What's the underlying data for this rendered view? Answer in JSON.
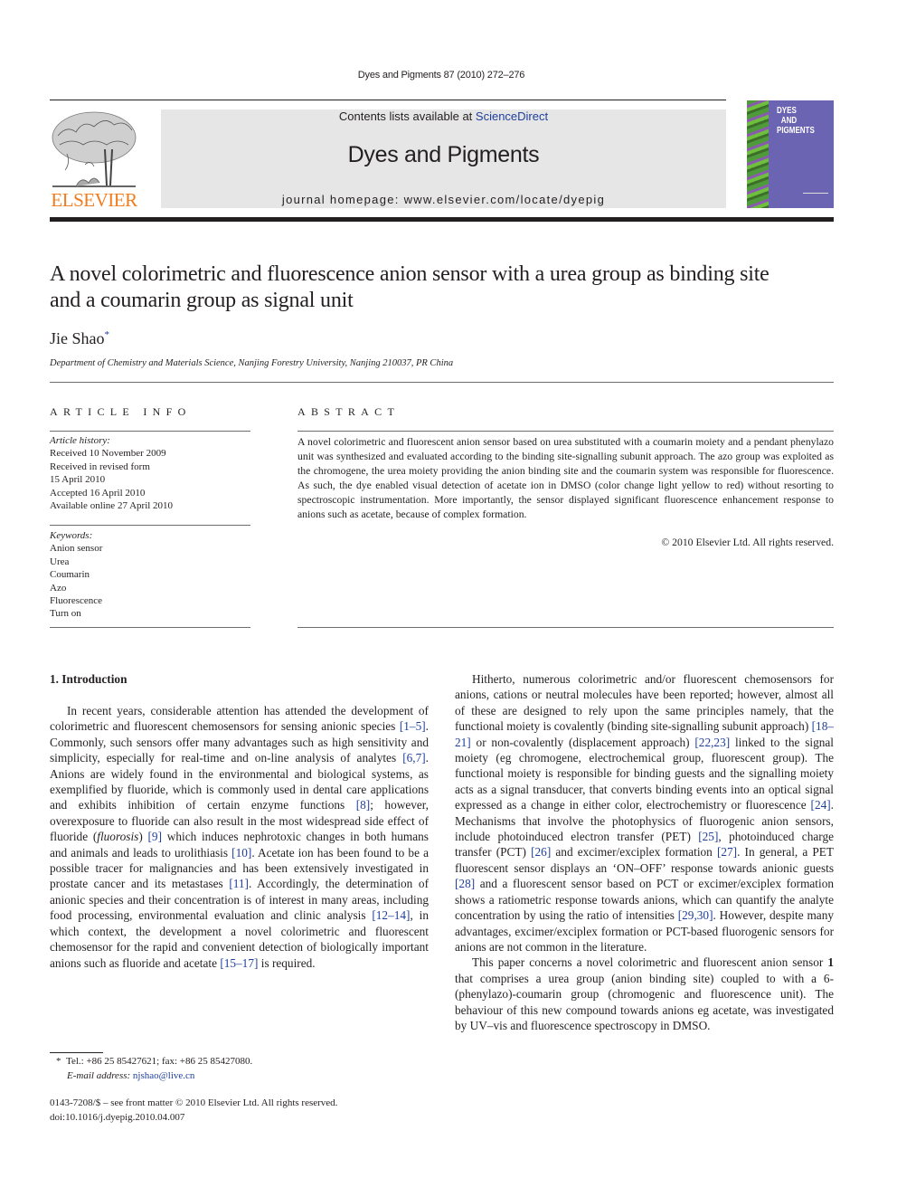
{
  "running_head": "Dyes and Pigments 87 (2010) 272–276",
  "banner": {
    "contents_prefix": "Contents lists available at ",
    "contents_link": "ScienceDirect",
    "journal_title": "Dyes and Pigments",
    "homepage": "journal homepage: www.elsevier.com/locate/dyepig"
  },
  "publisher_logo": {
    "wordmark": "ELSEVIER",
    "color": "#f07c1d"
  },
  "cover": {
    "title_lines": [
      "Dyes",
      "and",
      "Pigments"
    ],
    "color": "#6b64b2"
  },
  "article": {
    "title": "A novel colorimetric and fluorescence anion sensor with a urea group as binding site and a coumarin group as signal unit",
    "author": "Jie Shao",
    "author_mark": "*",
    "affiliation": "Department of Chemistry and Materials Science, Nanjing Forestry University, Nanjing 210037, PR China"
  },
  "article_info": {
    "heading": "ARTICLE INFO",
    "history_label": "Article history:",
    "history": [
      "Received 10 November 2009",
      "Received in revised form",
      "15 April 2010",
      "Accepted 16 April 2010",
      "Available online 27 April 2010"
    ],
    "keywords_label": "Keywords:",
    "keywords": [
      "Anion sensor",
      "Urea",
      "Coumarin",
      "Azo",
      "Fluorescence",
      "Turn on"
    ]
  },
  "abstract": {
    "heading": "ABSTRACT",
    "text": "A novel colorimetric and fluorescent anion sensor based on urea substituted with a coumarin moiety and a pendant phenylazo unit was synthesized and evaluated according to the binding site-signalling subunit approach. The azo group was exploited as the chromogene, the urea moiety providing the anion binding site and the coumarin system was responsible for fluorescence. As such, the dye enabled visual detection of acetate ion in DMSO (color change light yellow to red) without resorting to spectroscopic instrumentation. More importantly, the sensor displayed significant fluorescence enhancement response to anions such as acetate, because of complex formation.",
    "copyright": "© 2010 Elsevier Ltd. All rights reserved."
  },
  "introduction": {
    "heading": "1.  Introduction",
    "left_paragraph": [
      {
        "t": "In recent years, considerable attention has attended the development of colorimetric and fluorescent chemosensors for sensing anionic species "
      },
      {
        "ref": "[1–5]"
      },
      {
        "t": ". Commonly, such sensors offer many advantages such as high sensitivity and simplicity, especially for real-time and on-line analysis of analytes "
      },
      {
        "ref": "[6,7]"
      },
      {
        "t": ". Anions are widely found in the environmental and biological systems, as exemplified by fluoride, which is commonly used in dental care applications and exhibits inhibition of certain enzyme functions "
      },
      {
        "ref": "[8]"
      },
      {
        "t": "; however, overexposure to fluoride can also result in the most widespread side effect of fluoride ("
      },
      {
        "i": "fluorosis"
      },
      {
        "t": ") "
      },
      {
        "ref": "[9]"
      },
      {
        "t": " which induces nephrotoxic changes in both humans and animals and leads to urolithiasis "
      },
      {
        "ref": "[10]"
      },
      {
        "t": ". Acetate ion has been found to be a possible tracer for malignancies and has been extensively investigated in prostate cancer and its metastases "
      },
      {
        "ref": "[11]"
      },
      {
        "t": ". Accordingly, the determination of anionic species and their concentration is of interest in many areas, including food processing, environmental evaluation and clinic analysis "
      },
      {
        "ref": "[12–14]"
      },
      {
        "t": ", in which context, the development a novel colorimetric and fluorescent chemosensor for the rapid and convenient detection of biologically important anions such as fluoride and acetate "
      },
      {
        "ref": "[15–17]"
      },
      {
        "t": " is required."
      }
    ],
    "right_paragraph_1": [
      {
        "t": "Hitherto, numerous colorimetric and/or fluorescent chemosensors for anions, cations or neutral molecules have been reported; however, almost all of these are designed to rely upon the same principles namely, that the functional moiety is covalently (binding site-signalling subunit approach) "
      },
      {
        "ref": "[18–21]"
      },
      {
        "t": " or non-covalently (displacement approach) "
      },
      {
        "ref": "[22,23]"
      },
      {
        "t": " linked to the signal moiety (eg chromogene, electrochemical group, fluorescent group). The functional moiety is responsible for binding guests and the signalling moiety acts as a signal transducer, that converts binding events into an optical signal expressed as a change in either color, electrochemistry or fluorescence "
      },
      {
        "ref": "[24]"
      },
      {
        "t": ". Mechanisms that involve the photophysics of fluorogenic anion sensors, include photoinduced electron transfer (PET) "
      },
      {
        "ref": "[25]"
      },
      {
        "t": ", photoinduced charge transfer (PCT) "
      },
      {
        "ref": "[26]"
      },
      {
        "t": " and excimer/exciplex formation "
      },
      {
        "ref": "[27]"
      },
      {
        "t": ". In general, a PET fluorescent sensor displays an ‘ON–OFF’ response towards anionic guests "
      },
      {
        "ref": "[28]"
      },
      {
        "t": " and a fluorescent sensor based on PCT or excimer/exciplex formation shows a ratiometric response towards anions, which can quantify the analyte concentration by using the ratio of intensities "
      },
      {
        "ref": "[29,30]"
      },
      {
        "t": ". However, despite many advantages, excimer/exciplex formation or PCT-based fluorogenic sensors for anions are not common in the literature."
      }
    ],
    "right_paragraph_2": [
      {
        "t": "This paper concerns a novel colorimetric and fluorescent anion sensor "
      },
      {
        "b": "1"
      },
      {
        "t": " that comprises a urea group (anion binding site) coupled to with a 6-(phenylazo)-coumarin group (chromogenic and fluorescence unit). The behaviour of this new compound towards anions eg acetate, was investigated by UV–vis and fluorescence spectroscopy in DMSO."
      }
    ]
  },
  "footnote": {
    "mark": "*",
    "contact": "Tel.: +86 25 85427621; fax: +86 25 85427080.",
    "email_label": "E-mail address: ",
    "email": "njshao@live.cn"
  },
  "front_matter": {
    "issn_line": "0143-7208/$ – see front matter © 2010 Elsevier Ltd. All rights reserved.",
    "doi": "doi:10.1016/j.dyepig.2010.04.007"
  },
  "colors": {
    "link": "#1f3f9c",
    "banner_bg": "#e6e6e6",
    "text": "#231f20"
  }
}
